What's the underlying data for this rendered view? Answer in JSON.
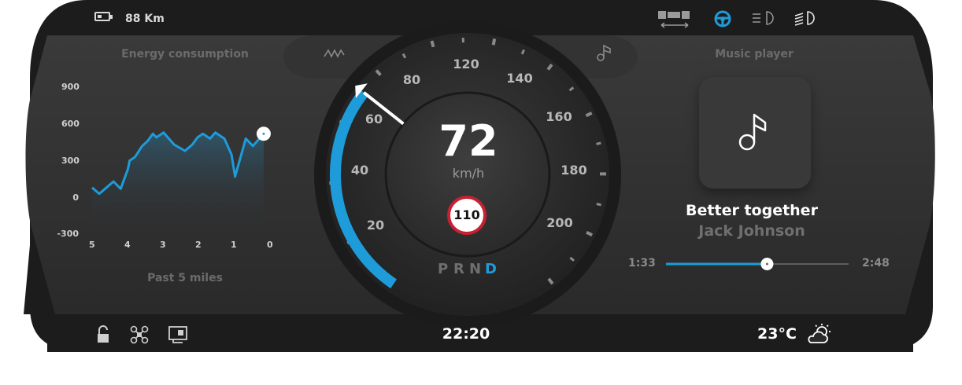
{
  "topbar": {
    "range": "88 Km",
    "icons": [
      "battery-icon",
      "seatbelt-icon",
      "steering-wheel-icon",
      "low-beam-icon",
      "high-beam-icon"
    ],
    "active_color": "#1e9bd9"
  },
  "energy": {
    "title": "Energy consumption",
    "footer": "Past 5 miles",
    "y_ticks": [
      "900",
      "600",
      "300",
      "0",
      "-300"
    ],
    "x_ticks": [
      "5",
      "4",
      "3",
      "2",
      "1",
      "0"
    ]
  },
  "chart_data": {
    "type": "line",
    "title": "Energy consumption",
    "xlabel": "Past 5 miles",
    "ylabel": "",
    "x": [
      5,
      4.8,
      4.6,
      4.4,
      4.2,
      4.0,
      3.95,
      3.8,
      3.6,
      3.45,
      3.3,
      3.2,
      3.0,
      2.7,
      2.4,
      2.2,
      2.05,
      1.9,
      1.7,
      1.55,
      1.3,
      1.1,
      1.0,
      0.7,
      0.5,
      0.35,
      0.2
    ],
    "y": [
      80,
      30,
      80,
      130,
      70,
      230,
      300,
      330,
      420,
      460,
      520,
      490,
      530,
      430,
      380,
      430,
      490,
      520,
      480,
      530,
      480,
      350,
      170,
      480,
      420,
      470,
      520
    ],
    "xlim": [
      5,
      0
    ],
    "ylim": [
      -300,
      900
    ],
    "color": "#1e9bd9",
    "grid": false,
    "current_marker": "end"
  },
  "speedometer": {
    "speed": "72",
    "unit": "km/h",
    "speed_limit": "110",
    "dial_numbers": [
      "20",
      "40",
      "60",
      "80",
      "120",
      "140",
      "160",
      "180",
      "200"
    ],
    "gears": [
      "P",
      "R",
      "N",
      "D"
    ],
    "active_gear": "D",
    "side_icons": [
      "energy-mode-icon",
      "music-mode-icon"
    ]
  },
  "music": {
    "title": "Music player",
    "song": "Better together",
    "artist": "Jack Johnson",
    "elapsed": "1:33",
    "total": "2:48",
    "progress": 0.5536
  },
  "bottombar": {
    "clock": "22:20",
    "temperature": "23°C",
    "icons": [
      "lock-icon",
      "drone-icon",
      "camera-icon",
      "partly-cloudy-icon"
    ]
  }
}
